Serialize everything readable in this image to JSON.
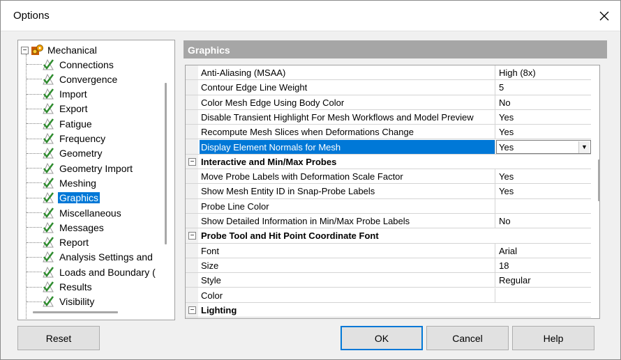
{
  "window": {
    "title": "Options"
  },
  "tree": {
    "root": {
      "label": "Mechanical",
      "expander": "−"
    },
    "items": [
      {
        "label": "Connections",
        "selected": false
      },
      {
        "label": "Convergence",
        "selected": false
      },
      {
        "label": "Import",
        "selected": false
      },
      {
        "label": "Export",
        "selected": false
      },
      {
        "label": "Fatigue",
        "selected": false
      },
      {
        "label": "Frequency",
        "selected": false
      },
      {
        "label": "Geometry",
        "selected": false
      },
      {
        "label": "Geometry Import",
        "selected": false
      },
      {
        "label": "Meshing",
        "selected": false
      },
      {
        "label": "Graphics",
        "selected": true
      },
      {
        "label": "Miscellaneous",
        "selected": false
      },
      {
        "label": "Messages",
        "selected": false
      },
      {
        "label": "Report",
        "selected": false
      },
      {
        "label": "Analysis Settings and",
        "selected": false
      },
      {
        "label": "Loads and Boundary (",
        "selected": false
      },
      {
        "label": "Results",
        "selected": false
      },
      {
        "label": "Visibility",
        "selected": false
      }
    ]
  },
  "panel": {
    "header": "Graphics",
    "rows": [
      {
        "kind": "prop",
        "name": "Anti-Aliasing (MSAA)",
        "value": "High (8x)"
      },
      {
        "kind": "prop",
        "name": "Contour Edge Line Weight",
        "value": "5"
      },
      {
        "kind": "prop",
        "name": "Color Mesh Edge Using Body Color",
        "value": "No"
      },
      {
        "kind": "prop",
        "name": "Disable Transient Highlight For Mesh Workflows and Model Preview",
        "value": "Yes"
      },
      {
        "kind": "prop",
        "name": "Recompute Mesh Slices when Deformations Change",
        "value": "Yes"
      },
      {
        "kind": "prop",
        "name": "Display Element Normals for Mesh",
        "value": "Yes",
        "selected": true
      },
      {
        "kind": "cat",
        "name": "Interactive and Min/Max Probes",
        "toggle": "−"
      },
      {
        "kind": "prop",
        "name": "Move Probe Labels with Deformation Scale Factor",
        "value": "Yes"
      },
      {
        "kind": "prop",
        "name": "Show Mesh Entity ID in Snap-Probe Labels",
        "value": "Yes"
      },
      {
        "kind": "prop",
        "name": "Probe Line Color",
        "value": ""
      },
      {
        "kind": "prop",
        "name": "Show Detailed Information in Min/Max Probe Labels",
        "value": "No"
      },
      {
        "kind": "cat",
        "name": "Probe Tool and Hit Point Coordinate Font",
        "toggle": "−"
      },
      {
        "kind": "prop",
        "name": "Font",
        "value": "Arial"
      },
      {
        "kind": "prop",
        "name": "Size",
        "value": "18"
      },
      {
        "kind": "prop",
        "name": "Style",
        "value": "Regular"
      },
      {
        "kind": "prop",
        "name": "Color",
        "value": ""
      },
      {
        "kind": "cat",
        "name": "Lighting",
        "toggle": "−"
      }
    ]
  },
  "buttons": {
    "reset": "Reset",
    "ok": "OK",
    "cancel": "Cancel",
    "help": "Help"
  },
  "colors": {
    "selection": "#0078d7",
    "header_bg": "#a6a6a6",
    "check_green": "#2e8b2e"
  }
}
